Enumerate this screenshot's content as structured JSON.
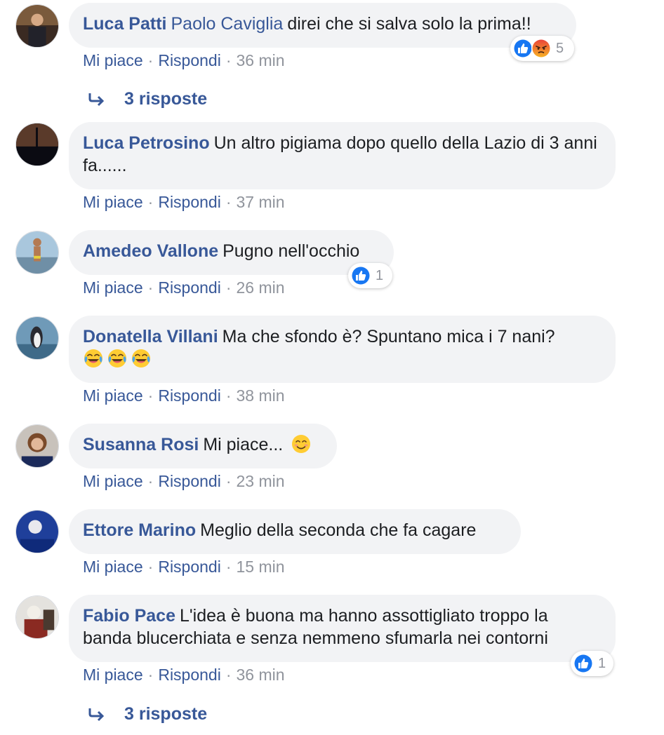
{
  "colors": {
    "link": "#385898",
    "bubble": "#f2f3f5",
    "meta": "#90949c",
    "like_blue": "#1877f2",
    "angry_orange": "#f0731f"
  },
  "comments": [
    {
      "author": "Luca Patti",
      "tag": "Paolo Caviglia",
      "text": "direi che si salva solo la prima!!",
      "like": "Mi piace",
      "reply": "Rispondi",
      "sep": "·",
      "time": "36 min",
      "reactions": {
        "icons": [
          "like-icon",
          "angry-icon"
        ],
        "count": "5"
      },
      "replies": "3 risposte"
    },
    {
      "author": "Luca Petrosino",
      "text": "Un altro pigiama dopo quello della Lazio di 3 anni fa......",
      "like": "Mi piace",
      "reply": "Rispondi",
      "sep": "·",
      "time": "37 min"
    },
    {
      "author": "Amedeo Vallone",
      "text": "Pugno nell'occhio",
      "like": "Mi piace",
      "reply": "Rispondi",
      "sep": "·",
      "time": "26 min",
      "reactions": {
        "icons": [
          "like-icon"
        ],
        "count": "1"
      }
    },
    {
      "author": "Donatella Villani",
      "text": "Ma che sfondo è? Spuntano mica i 7 nani?",
      "emojis": [
        "laughing-tears-emoji",
        "laughing-tears-emoji",
        "laughing-tears-emoji"
      ],
      "like": "Mi piace",
      "reply": "Rispondi",
      "sep": "·",
      "time": "38 min"
    },
    {
      "author": "Susanna Rosi",
      "text": "Mi piace...",
      "emojis": [
        "smiling-emoji"
      ],
      "like": "Mi piace",
      "reply": "Rispondi",
      "sep": "·",
      "time": "23 min"
    },
    {
      "author": "Ettore Marino",
      "text": "Meglio della seconda che fa cagare",
      "like": "Mi piace",
      "reply": "Rispondi",
      "sep": "·",
      "time": "15 min"
    },
    {
      "author": "Fabio Pace",
      "text": "L'idea è buona ma hanno assottigliato troppo la banda blucerchiata e senza nemmeno sfumarla nei contorni",
      "like": "Mi piace",
      "reply": "Rispondi",
      "sep": "·",
      "time": "36 min",
      "reactions": {
        "icons": [
          "like-icon"
        ],
        "count": "1"
      },
      "replies": "3 risposte"
    }
  ]
}
